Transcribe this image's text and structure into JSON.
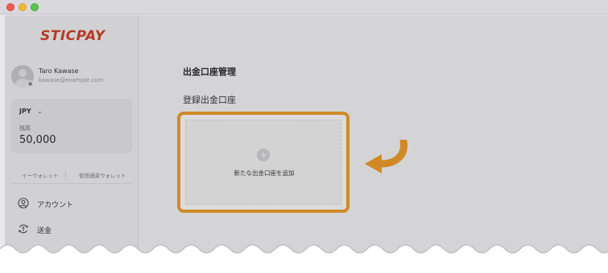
{
  "window": {
    "controls": [
      "close",
      "minimize",
      "maximize"
    ]
  },
  "sidebar": {
    "logo": "STICPAY",
    "user": {
      "name": "Taro Kawase",
      "email": "kawase@example.com"
    },
    "balance": {
      "currency": "JPY",
      "label": "残高",
      "amount": "50,000"
    },
    "wallet_tabs": [
      "イーウォレット",
      "仮想通貨ウォレット"
    ],
    "nav": [
      {
        "label": "アカウント",
        "icon": "account-circle-icon"
      },
      {
        "label": "送金",
        "icon": "send-money-icon"
      }
    ]
  },
  "main": {
    "page_title": "出金口座管理",
    "section_title": "登録出金口座",
    "add_account_label": "新たな出金口座を追加"
  },
  "colors": {
    "brand": "#d23b1d",
    "highlight": "#f29a21"
  }
}
